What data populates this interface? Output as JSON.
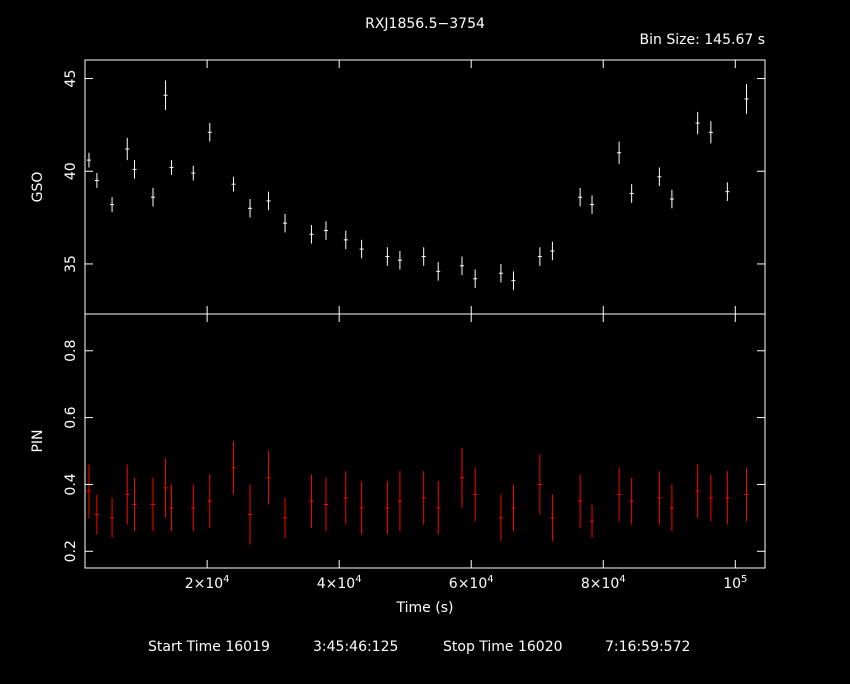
{
  "chart_data": {
    "type": "scatter",
    "title": "RXJ1856.5−3754",
    "bin_size_label": "Bin Size: 145.67 s",
    "xlabel": "Time (s)",
    "xlim": [
      1500,
      104500
    ],
    "x_ticks": [
      {
        "value": 20000,
        "mantissa": "2×10",
        "exp": "4"
      },
      {
        "value": 40000,
        "mantissa": "4×10",
        "exp": "4"
      },
      {
        "value": 60000,
        "mantissa": "6×10",
        "exp": "4"
      },
      {
        "value": 80000,
        "mantissa": "8×10",
        "exp": "4"
      },
      {
        "value": 100000,
        "mantissa": "10",
        "exp": "5"
      }
    ],
    "panels": [
      {
        "name": "GSO",
        "ylabel": "GSO",
        "ylim": [
          32.3,
          46
        ],
        "y_ticks": [
          35,
          40,
          45
        ],
        "color": "#ffffff",
        "series": [
          {
            "x": 2100,
            "y": 40.6,
            "err": 0.4
          },
          {
            "x": 3300,
            "y": 39.5,
            "err": 0.4
          },
          {
            "x": 5600,
            "y": 38.2,
            "err": 0.4
          },
          {
            "x": 7900,
            "y": 41.2,
            "err": 0.6
          },
          {
            "x": 9000,
            "y": 40.1,
            "err": 0.5
          },
          {
            "x": 11800,
            "y": 38.6,
            "err": 0.5
          },
          {
            "x": 13700,
            "y": 44.1,
            "err": 0.8
          },
          {
            "x": 14600,
            "y": 40.2,
            "err": 0.4
          },
          {
            "x": 17900,
            "y": 39.9,
            "err": 0.4
          },
          {
            "x": 20400,
            "y": 42.1,
            "err": 0.5
          },
          {
            "x": 24000,
            "y": 39.3,
            "err": 0.4
          },
          {
            "x": 26500,
            "y": 38.0,
            "err": 0.5
          },
          {
            "x": 29300,
            "y": 38.4,
            "err": 0.5
          },
          {
            "x": 31800,
            "y": 37.2,
            "err": 0.5
          },
          {
            "x": 35800,
            "y": 36.6,
            "err": 0.5
          },
          {
            "x": 38000,
            "y": 36.8,
            "err": 0.5
          },
          {
            "x": 41000,
            "y": 36.3,
            "err": 0.5
          },
          {
            "x": 43400,
            "y": 35.8,
            "err": 0.5
          },
          {
            "x": 47300,
            "y": 35.4,
            "err": 0.5
          },
          {
            "x": 49200,
            "y": 35.2,
            "err": 0.5
          },
          {
            "x": 52800,
            "y": 35.4,
            "err": 0.5
          },
          {
            "x": 55000,
            "y": 34.6,
            "err": 0.5
          },
          {
            "x": 58600,
            "y": 34.9,
            "err": 0.5
          },
          {
            "x": 60600,
            "y": 34.2,
            "err": 0.5
          },
          {
            "x": 64500,
            "y": 34.5,
            "err": 0.5
          },
          {
            "x": 66400,
            "y": 34.1,
            "err": 0.5
          },
          {
            "x": 70400,
            "y": 35.4,
            "err": 0.5
          },
          {
            "x": 72300,
            "y": 35.7,
            "err": 0.5
          },
          {
            "x": 76500,
            "y": 38.6,
            "err": 0.5
          },
          {
            "x": 78300,
            "y": 38.2,
            "err": 0.5
          },
          {
            "x": 82400,
            "y": 41.0,
            "err": 0.6
          },
          {
            "x": 84300,
            "y": 38.8,
            "err": 0.5
          },
          {
            "x": 88500,
            "y": 39.7,
            "err": 0.5
          },
          {
            "x": 90400,
            "y": 38.5,
            "err": 0.5
          },
          {
            "x": 94300,
            "y": 42.6,
            "err": 0.6
          },
          {
            "x": 96300,
            "y": 42.1,
            "err": 0.6
          },
          {
            "x": 98800,
            "y": 38.9,
            "err": 0.5
          },
          {
            "x": 101700,
            "y": 43.9,
            "err": 0.8
          }
        ]
      },
      {
        "name": "PIN",
        "ylabel": "PIN",
        "ylim": [
          0.15,
          0.91
        ],
        "y_ticks": [
          0.2,
          0.4,
          0.6,
          0.8
        ],
        "y_tick_labels": [
          "0.2",
          "0.4",
          "0.6",
          "0.8"
        ],
        "color": "#ff0000",
        "series": [
          {
            "x": 2100,
            "y": 0.38,
            "err": 0.08
          },
          {
            "x": 3300,
            "y": 0.31,
            "err": 0.06
          },
          {
            "x": 5600,
            "y": 0.3,
            "err": 0.06
          },
          {
            "x": 7900,
            "y": 0.37,
            "err": 0.09
          },
          {
            "x": 9000,
            "y": 0.34,
            "err": 0.08
          },
          {
            "x": 11800,
            "y": 0.34,
            "err": 0.08
          },
          {
            "x": 13700,
            "y": 0.39,
            "err": 0.09
          },
          {
            "x": 14600,
            "y": 0.33,
            "err": 0.07
          },
          {
            "x": 17900,
            "y": 0.33,
            "err": 0.07
          },
          {
            "x": 20400,
            "y": 0.35,
            "err": 0.08
          },
          {
            "x": 24000,
            "y": 0.45,
            "err": 0.08
          },
          {
            "x": 26500,
            "y": 0.31,
            "err": 0.09
          },
          {
            "x": 29300,
            "y": 0.42,
            "err": 0.08
          },
          {
            "x": 31800,
            "y": 0.3,
            "err": 0.06
          },
          {
            "x": 35800,
            "y": 0.35,
            "err": 0.08
          },
          {
            "x": 38000,
            "y": 0.34,
            "err": 0.08
          },
          {
            "x": 41000,
            "y": 0.36,
            "err": 0.08
          },
          {
            "x": 43400,
            "y": 0.33,
            "err": 0.08
          },
          {
            "x": 47300,
            "y": 0.33,
            "err": 0.08
          },
          {
            "x": 49200,
            "y": 0.35,
            "err": 0.09
          },
          {
            "x": 52800,
            "y": 0.36,
            "err": 0.08
          },
          {
            "x": 55000,
            "y": 0.33,
            "err": 0.08
          },
          {
            "x": 58600,
            "y": 0.42,
            "err": 0.09
          },
          {
            "x": 60600,
            "y": 0.37,
            "err": 0.08
          },
          {
            "x": 64500,
            "y": 0.3,
            "err": 0.07
          },
          {
            "x": 66400,
            "y": 0.33,
            "err": 0.07
          },
          {
            "x": 70400,
            "y": 0.4,
            "err": 0.09
          },
          {
            "x": 72300,
            "y": 0.3,
            "err": 0.07
          },
          {
            "x": 76500,
            "y": 0.35,
            "err": 0.08
          },
          {
            "x": 78300,
            "y": 0.29,
            "err": 0.05
          },
          {
            "x": 82400,
            "y": 0.37,
            "err": 0.08
          },
          {
            "x": 84300,
            "y": 0.35,
            "err": 0.07
          },
          {
            "x": 88500,
            "y": 0.36,
            "err": 0.08
          },
          {
            "x": 90400,
            "y": 0.33,
            "err": 0.07
          },
          {
            "x": 94300,
            "y": 0.38,
            "err": 0.08
          },
          {
            "x": 96300,
            "y": 0.36,
            "err": 0.07
          },
          {
            "x": 98800,
            "y": 0.36,
            "err": 0.08
          },
          {
            "x": 101700,
            "y": 0.37,
            "err": 0.08
          }
        ]
      }
    ]
  },
  "footer": {
    "start_label": "Start Time 16019",
    "start_time": "3:45:46:125",
    "stop_label": "Stop Time 16020",
    "stop_time": "7:16:59:572"
  }
}
